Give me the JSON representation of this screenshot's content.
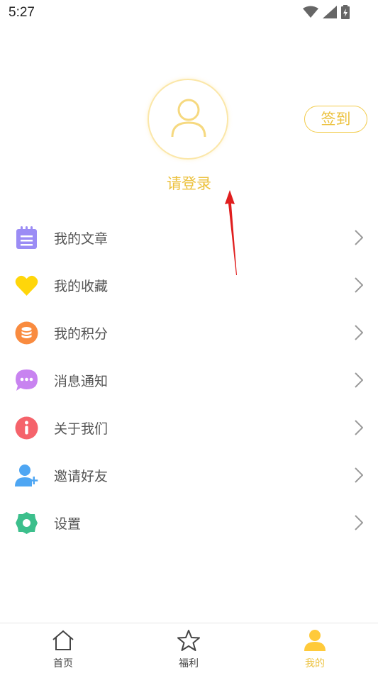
{
  "status_bar": {
    "time": "5:27"
  },
  "profile": {
    "login_prompt": "请登录",
    "signin_button": "签到",
    "accent_color": "#ecc23f"
  },
  "menu": {
    "items": [
      {
        "label": "我的文章",
        "icon": "notepad-icon",
        "color": "#9b8cf5"
      },
      {
        "label": "我的收藏",
        "icon": "heart-icon",
        "color": "#ffd60a"
      },
      {
        "label": "我的积分",
        "icon": "coins-icon",
        "color": "#f98b3f"
      },
      {
        "label": "消息通知",
        "icon": "chat-bubble-icon",
        "color": "#c883f0"
      },
      {
        "label": "关于我们",
        "icon": "info-icon",
        "color": "#f5636b"
      },
      {
        "label": "邀请好友",
        "icon": "add-user-icon",
        "color": "#4ea6f3"
      },
      {
        "label": "设置",
        "icon": "gear-icon",
        "color": "#3cbf8c"
      }
    ]
  },
  "tabbar": {
    "tabs": [
      {
        "label": "首页",
        "icon": "home-icon",
        "active": false
      },
      {
        "label": "福利",
        "icon": "star-icon",
        "active": false
      },
      {
        "label": "我的",
        "icon": "user-icon",
        "active": true
      }
    ]
  }
}
